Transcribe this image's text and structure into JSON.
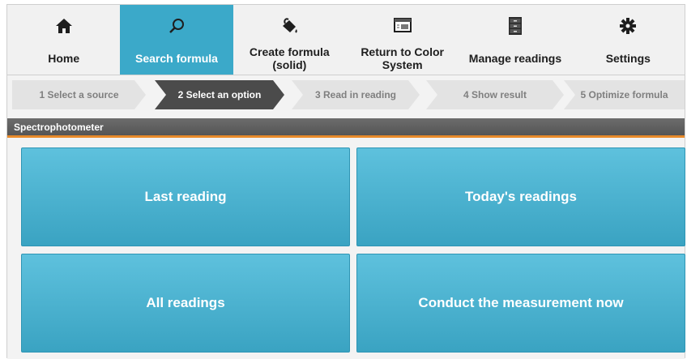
{
  "nav": {
    "items": [
      {
        "label": "Home",
        "icon": "home-icon"
      },
      {
        "label": "Search formula",
        "icon": "search-icon",
        "active": true
      },
      {
        "label": "Create formula (solid)",
        "icon": "paint-bucket-icon"
      },
      {
        "label": "Return to Color System",
        "icon": "monitor-icon"
      },
      {
        "label": "Manage readings",
        "icon": "file-cabinet-icon"
      },
      {
        "label": "Settings",
        "icon": "gear-icon"
      }
    ]
  },
  "steps": [
    {
      "label": "1 Select a source"
    },
    {
      "label": "2 Select an option",
      "current": true
    },
    {
      "label": "3 Read in reading"
    },
    {
      "label": "4 Show result"
    },
    {
      "label": "5 Optimize formula"
    }
  ],
  "section": {
    "title": "Spectrophotometer"
  },
  "options": {
    "last_reading": "Last reading",
    "todays_readings": "Today's readings",
    "all_readings": "All readings",
    "conduct_measurement": "Conduct the measurement now"
  },
  "colors": {
    "accent": "#3ba9c9",
    "tile": "#4db4d2",
    "step_current": "#4b4b4b",
    "section_underline": "#e88a2a"
  }
}
